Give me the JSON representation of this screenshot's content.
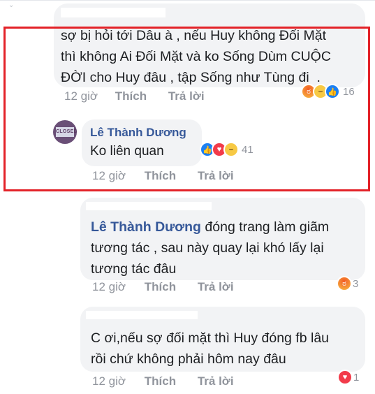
{
  "comments": [
    {
      "author": "",
      "text_lines": [
        "sợ bị hỏi tới Dâu à , nếu Huy không Đối Mặt",
        "thì không Ai Đối Mặt và ko Sống Dùm CUỘC",
        "ĐỜI cho Huy đâu , tập Sống như Tùng đi  ."
      ],
      "time": "12 giờ",
      "like_label": "Thích",
      "reply_label": "Trả lời",
      "reactions": [
        "angry",
        "haha",
        "like"
      ],
      "reaction_count": "16"
    },
    {
      "author": "Lê Thành Dương",
      "avatar_text": "CLOSED",
      "text": "Ko liên quan",
      "time": "12 giờ",
      "like_label": "Thích",
      "reply_label": "Trả lời",
      "reactions": [
        "like",
        "love",
        "haha"
      ],
      "reaction_count": "41"
    },
    {
      "author": "Lê Thành Dương",
      "text_first": "đóng trang làm giãm",
      "text_lines": [
        "tương tác , sau này quay lại khó lấy lại",
        "tương tác đâu"
      ],
      "time": "12 giờ",
      "like_label": "Thích",
      "reply_label": "Trả lời",
      "reactions": [
        "angry"
      ],
      "reaction_count": "3"
    },
    {
      "author": "",
      "text_lines": [
        "C ơi,nếu sợ đối mặt thì Huy đóng fb lâu",
        "rồi chứ không phải hôm nay đâu"
      ],
      "time": "12 giờ",
      "like_label": "Thích",
      "reply_label": "Trả lời",
      "reactions": [
        "love"
      ],
      "reaction_count": "1"
    }
  ],
  "colors": {
    "highlight_border": "#e32228",
    "bubble": "#f2f3f5",
    "author_name": "#365899",
    "meta": "#90949c"
  }
}
